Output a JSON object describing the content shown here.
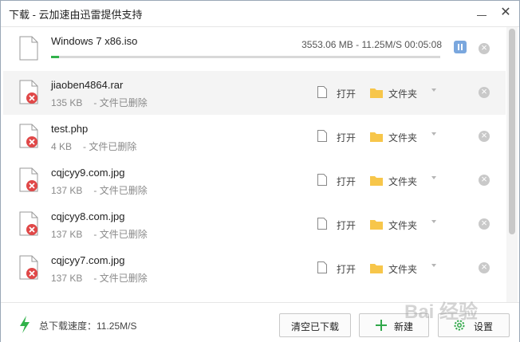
{
  "window": {
    "title": "下载 - 云加速由迅雷提供支持"
  },
  "active_download": {
    "name": "Windows 7 x86.iso",
    "progress_info": "3553.06 MB - 11.25M/S 00:05:08",
    "progress_fraction": 0.02
  },
  "files": [
    {
      "name": "jiaoben4864.rar",
      "size": "135 KB",
      "status": "- 文件已删除"
    },
    {
      "name": "test.php",
      "size": "4 KB",
      "status": "- 文件已删除"
    },
    {
      "name": "cqjcyy9.com.jpg",
      "size": "137 KB",
      "status": "- 文件已删除"
    },
    {
      "name": "cqjcyy8.com.jpg",
      "size": "137 KB",
      "status": "- 文件已删除"
    },
    {
      "name": "cqjcyy7.com.jpg",
      "size": "137 KB",
      "status": "- 文件已删除"
    }
  ],
  "row_actions": {
    "open": "打开",
    "folder": "文件夹"
  },
  "footer": {
    "speed": "总下载速度：11.25M/S",
    "clear_label": "清空已下载",
    "new_label": "新建",
    "settings_label": "设置"
  },
  "watermark": "Bai 经验",
  "colors": {
    "accent_green": "#31b24a",
    "error_red": "#e04848",
    "folder_yellow": "#f7c64a",
    "pause_blue": "#7aa7de"
  },
  "icons": [
    "file-icon",
    "error-badge-icon",
    "pause-icon",
    "delete-icon",
    "open-file-icon",
    "folder-icon",
    "caret-down-icon",
    "bolt-icon",
    "plus-icon",
    "gear-icon",
    "minimize-icon",
    "close-icon"
  ]
}
